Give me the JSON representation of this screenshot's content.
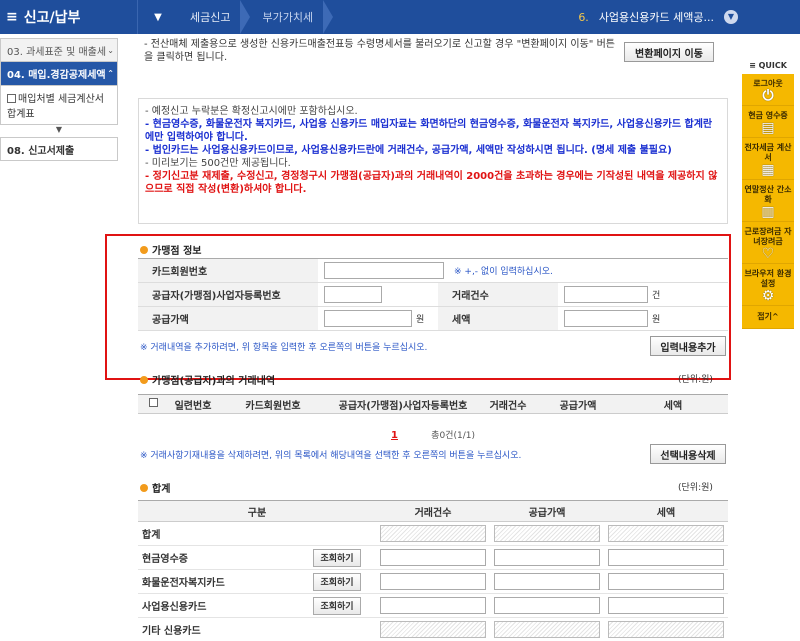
{
  "topbar": {
    "menu_label": "신고/납부",
    "breadcrumbs": [
      "세금신고",
      "부가가치세"
    ],
    "right_num": "6.",
    "right_label": "사업용신용카드 세액공...",
    "colors": {
      "bar": "#1f4e9c",
      "accent": "#f5c74a"
    }
  },
  "leftnav": {
    "items": [
      {
        "label": "03. 과세표준 및 매출세",
        "active": false
      },
      {
        "label": "04. 매입.경감공제세액",
        "active": true
      }
    ],
    "sub_label": "매입처별 세금계산서 합계표",
    "last_item": "08. 신고서제출"
  },
  "quick": {
    "header": "QUICK",
    "items": [
      {
        "label": "로그아웃",
        "icon": "logout-icon",
        "glyph": "⏻"
      },
      {
        "label": "현금 영수증",
        "icon": "receipt-icon",
        "glyph": "▤"
      },
      {
        "label": "전자세금 계산서",
        "icon": "invoice-icon",
        "glyph": "▦"
      },
      {
        "label": "연말정산 간소화",
        "icon": "document-icon",
        "glyph": "▥"
      },
      {
        "label": "근로장려금 자녀장려금",
        "icon": "heart-icon",
        "glyph": "♡"
      },
      {
        "label": "브라우저 환경설정",
        "icon": "gear-icon",
        "glyph": "⚙"
      }
    ],
    "close_label": "접기^"
  },
  "intro": {
    "text": "- 전산매체 제출용으로 생성한 신용카드매출전표등 수령명세서를 불러오기로 신고할 경우 \"변환페이지 이동\" 버튼을 클릭하면 됩니다.",
    "button": "변환페이지 이동"
  },
  "notice": {
    "line1": "- 예정신고 누락분은 확정신고시에만 포함하십시오.",
    "line2": "- 현금영수증, 화물운전자 복지카드, 사업용 신용카드 매입자료는 화면하단의 현금영수증, 화물운전자 복지카드, 사업용신용카드 합계란에만 입력하여야 합니다.",
    "line3": "- 법인카드는 사업용신용카드이므로, 사업용신용카드란에 거래건수, 공급가액, 세액만 작성하시면 됩니다. (명세 제출 불필요)",
    "line4": "- 미리보기는 500건만 제공됩니다.",
    "line5": "- 정기신고분 재제출, 수정신고, 경정청구시 가맹점(공급자)과의 거래내역이 2000건을 초과하는 경우에는 기작성된 내역을 제공하지 않으므로 직접 작성(변환)하셔야 합니다."
  },
  "merchant": {
    "title": "가맹점 정보",
    "card_label": "카드회원번호",
    "card_hint": "※ +,- 없이 입력하십시오.",
    "bizno_label": "공급자(가맹점)사업자등록번호",
    "count_label": "거래건수",
    "count_unit": "건",
    "supply_label": "공급가액",
    "supply_unit": "원",
    "tax_label": "세액",
    "tax_unit": "원",
    "note": "※ 거래내역을 추가하려면, 위 항목을 입력한 후 오른쪽의 버튼을 누르십시오.",
    "add_button": "입력내용추가"
  },
  "transactions": {
    "title": "가맹점(공급자)과의 거래내역",
    "unit": "(단위:원)",
    "columns": [
      "일련번호",
      "카드회원번호",
      "공급자(가맹점)사업자등록번호",
      "거래건수",
      "공급가액",
      "세액"
    ],
    "page": "1",
    "count_text": "총0건(1/1)",
    "note": "※ 거래사항기재내용을 삭제하려면, 위의 목록에서 해당내역을 선택한 후 오른쪽의 버튼을 누르십시오.",
    "delete_button": "선택내용삭제"
  },
  "summary": {
    "title": "합계",
    "unit": "(단위:원)",
    "columns": [
      "구분",
      "거래건수",
      "공급가액",
      "세액"
    ],
    "rows": [
      {
        "label": "합계",
        "button": null,
        "readonly": true
      },
      {
        "label": "현금영수증",
        "button": "조회하기",
        "readonly": false
      },
      {
        "label": "화물운전자복지카드",
        "button": "조회하기",
        "readonly": false
      },
      {
        "label": "사업용신용카드",
        "button": "조회하기",
        "readonly": false
      },
      {
        "label": "기타 신용카드",
        "button": null,
        "readonly": true
      }
    ]
  }
}
